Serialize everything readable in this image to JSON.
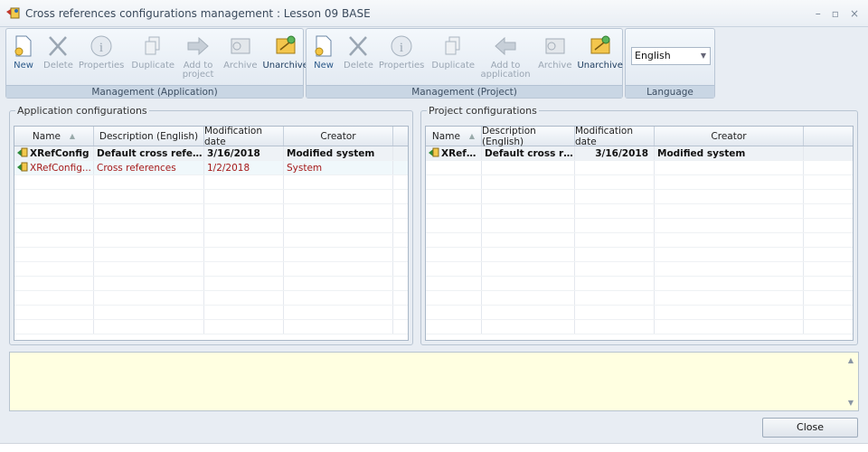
{
  "window": {
    "title": "Cross references configurations management : Lesson 09 BASE",
    "controls": {
      "minimize": "–",
      "maximize": "▫",
      "close": "×"
    }
  },
  "ribbon": {
    "app_group": {
      "label": "Management (Application)",
      "buttons": [
        {
          "label": "New",
          "icon": "new-doc-icon",
          "enabled": true
        },
        {
          "label": "Delete",
          "icon": "delete-x-icon",
          "enabled": false
        },
        {
          "label": "Properties",
          "icon": "info-icon",
          "enabled": false
        },
        {
          "label": "Duplicate",
          "icon": "duplicate-icon",
          "enabled": false
        },
        {
          "label": "Add to project",
          "icon": "arrow-right-icon",
          "enabled": false
        },
        {
          "label": "Archive",
          "icon": "archive-icon",
          "enabled": false
        },
        {
          "label": "Unarchive",
          "icon": "unarchive-icon",
          "enabled": true
        }
      ]
    },
    "project_group": {
      "label": "Management (Project)",
      "buttons": [
        {
          "label": "New",
          "icon": "new-doc-icon",
          "enabled": true
        },
        {
          "label": "Delete",
          "icon": "delete-x-icon",
          "enabled": false
        },
        {
          "label": "Properties",
          "icon": "info-icon",
          "enabled": false
        },
        {
          "label": "Duplicate",
          "icon": "duplicate-icon",
          "enabled": false
        },
        {
          "label": "Add to application",
          "icon": "arrow-left-icon",
          "enabled": false
        },
        {
          "label": "Archive",
          "icon": "archive-icon",
          "enabled": false
        },
        {
          "label": "Unarchive",
          "icon": "unarchive-icon",
          "enabled": true
        }
      ]
    },
    "language_group": {
      "label": "Language",
      "selected": "English"
    }
  },
  "app_panel": {
    "title": "Application configurations",
    "columns": [
      "Name",
      "Description (English)",
      "Modification date",
      "Creator"
    ],
    "rows": [
      {
        "name": "XRefConfig",
        "description": "Default cross referen...",
        "date": "3/16/2018",
        "creator": "Modified system",
        "style": "sel"
      },
      {
        "name": "XRefConfig...",
        "description": "Cross references",
        "date": "1/2/2018",
        "creator": "System",
        "style": "red"
      }
    ]
  },
  "project_panel": {
    "title": "Project configurations",
    "columns": [
      "Name",
      "Description (English)",
      "Modification date",
      "Creator"
    ],
    "rows": [
      {
        "name": "XRefC...",
        "description": "Default cross refe...",
        "date": "3/16/2018",
        "creator": "Modified system",
        "style": "sel"
      }
    ]
  },
  "footer": {
    "close_label": "Close"
  }
}
